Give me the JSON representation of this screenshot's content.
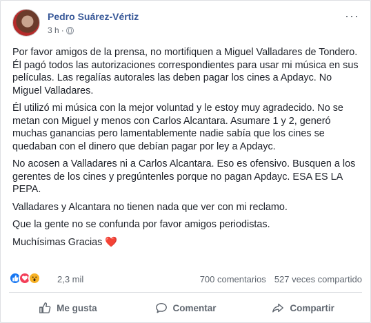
{
  "post": {
    "author": "Pedro Suárez-Vértiz",
    "time": "3 h",
    "separator": "·",
    "more_label": "···",
    "paragraphs": [
      "Por favor amigos de la prensa, no mortifiquen a Miguel Valladares de Tondero. Él pagó todos las autorizaciones correspondientes para usar mi música en sus películas. Las regalías autorales las deben pagar los cines a Apdayc. No Miguel Valladares.",
      "Él utilizó mi música con la mejor voluntad y le estoy muy agradecido. No se metan con Miguel y menos con Carlos Alcantara. Asumare 1 y 2, generó muchas ganancias pero lamentablemente nadie sabía que los cines se quedaban con el dinero que debían pagar por ley a Apdayc.",
      "No acosen a Valladares ni a Carlos Alcantara. Eso es ofensivo. Busquen a los gerentes de los cines y pregúntenles porque no pagan Apdayc. ESA ES LA PEPA.",
      "Valladares y Alcantara no tienen nada que ver con mi reclamo.",
      "Que la gente no se confunda por favor amigos periodistas."
    ],
    "closing": "Muchísimas Gracias",
    "closing_emoji": "❤️"
  },
  "stats": {
    "reactions_count": "2,3 mil",
    "comments": "700 comentarios",
    "shares": "527 veces compartido",
    "reaction_icons": [
      "like-icon",
      "love-icon",
      "wow-icon"
    ]
  },
  "actions": {
    "like": "Me gusta",
    "comment": "Comentar",
    "share": "Compartir"
  },
  "colors": {
    "author_link": "#385898",
    "like_blue": "#1877f2",
    "love_red": "#f33e58",
    "wow_yellow": "#f7b125",
    "muted_text": "#606770"
  }
}
